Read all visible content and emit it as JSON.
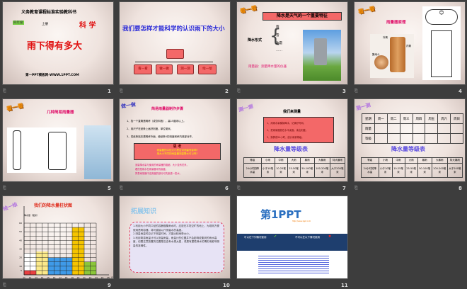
{
  "slides": [
    {
      "n": "1",
      "series": "义务教育课程标准实验教科书",
      "grade": "四年级",
      "term": "上册",
      "subject": "科 学",
      "title": "雨下得有多大",
      "footer": "第一PPT模板网-WWW.1PPT.COM"
    },
    {
      "n": "2",
      "title": "我们要怎样才能科学的认识雨下的大小",
      "root": "",
      "steps": [
        "看一看",
        "做一做",
        "测一测",
        "绘一绘"
      ]
    },
    {
      "n": "3",
      "tag": "看一看",
      "header": "降水是天气的一个重要特征",
      "label": "降水形式",
      "forms": [
        "雨",
        "雪",
        "冰雹",
        "……"
      ],
      "caption": "雨量器：测量降水量的仪器"
    },
    {
      "n": "4",
      "tag": "看一看",
      "title": "雨量器原理",
      "labels": [
        "外筒",
        "内筒",
        "集雨斗"
      ]
    },
    {
      "n": "5",
      "tag": "看一看",
      "title": "几种简易雨量器"
    },
    {
      "n": "6",
      "tag": "做一做",
      "title": "简易雨量器制作步骤",
      "steps": [
        "1、找一个直筒透明杯（或饮料瓶），高15厘米以上。",
        "2、用尺子在纸条上画好刻度，单位毫米。",
        "3、将纸条贴在透明杯外面，使纸条0的刻度和杯内底部对齐。"
      ],
      "think_title": "思 考",
      "think": [
        "雨量器的口径大小是否对测量有影响?",
        "用大小不同的雨量器测量降水可以吗?"
      ],
      "notes": [
        "测量降水量与使用的雨量器的粗细、大小没有关系，",
        "看的是雨水在雨量器中的高度。",
        "简易雨量器中没刻度的部分可先倒进一些水。"
      ]
    },
    {
      "n": "7",
      "tag": "测一测",
      "title": "我们来测量",
      "steps": [
        "1、用雨水量模拟降水，记录好时间。",
        "2、把雨量器放在水平桌面，读出刻度。",
        "3、换算成24小时，统计雨量等级。"
      ],
      "table_title": "降水量等级表",
      "header": [
        "等级",
        "小雨",
        "中雨",
        "大雨",
        "暴雨",
        "大暴雨",
        "特大暴雨"
      ],
      "row": [
        "24小时的降水量",
        "小于10毫米",
        "10-25毫米",
        "25-50毫米",
        "50-100毫米",
        "100-200毫米",
        "大于200毫米"
      ]
    },
    {
      "n": "8",
      "tag": "测一测",
      "week": [
        "星期",
        "周一",
        "周二",
        "周三",
        "周四",
        "周五",
        "周六",
        "周日"
      ],
      "rows": [
        "雨量",
        "等级"
      ],
      "table_title": "降水量等级表",
      "header": [
        "等级",
        "小雨",
        "中雨",
        "大雨",
        "暴雨",
        "大暴雨",
        "特大暴雨"
      ],
      "row": [
        "24小时的降水量",
        "小于10毫米",
        "10-25毫米",
        "25-50毫米",
        "50-100毫米",
        "100-200毫米",
        "大于200毫米"
      ]
    },
    {
      "n": "9",
      "tag": "绘一绘"
    },
    {
      "n": "10",
      "title": "拓展知识",
      "paras": [
        "1.利用大小不同口径的容器做集雨水时，应放在平坦空旷的地上，为观测方便使用透明容器，将可直接以尺测量水的高度。",
        "2.测量雨量时应记下测量时间，才能比较雨势大小。",
        "3.利用简易雨量计可以测量雨量，雨量计的位置并不会影响收集到的雨水高度，但要注意放置的位置是否会有水溅太高，或是有屋檐滴水的情形而影响测量的准确性。"
      ]
    },
    {
      "n": "11",
      "logo": "第1PPT",
      "url": "http://www.1ppt.com",
      "can": "可以在下列情况使用",
      "cannot": "不可以在以下情况使用"
    }
  ],
  "chart_data": {
    "type": "bar",
    "title": "我们的降水量柱状图",
    "ylabel": "降水量（毫米）",
    "xlabel": "日期",
    "x_ticks": [
      "11",
      "12",
      "13",
      "14",
      "15",
      "16",
      "17",
      "18",
      "19",
      "20",
      "21",
      "22",
      "23",
      "24",
      "25"
    ],
    "y_ticks": [
      5,
      10,
      20,
      30,
      40,
      50,
      60
    ],
    "ylim": [
      0,
      60
    ],
    "bars": [
      {
        "from": 11,
        "to": 13,
        "value": 5,
        "color": "#e84040"
      },
      {
        "from": 11,
        "to": 13,
        "value": 20,
        "color": "#ffffff",
        "base": 5
      },
      {
        "from": 13,
        "to": 15,
        "value": 27,
        "color": "#fbe98a"
      },
      {
        "from": 15,
        "to": 19,
        "value": 20,
        "color": "#3f9ae8"
      },
      {
        "from": 19,
        "to": 21,
        "value": 55,
        "color": "#f5c400"
      },
      {
        "from": 21,
        "to": 23,
        "value": 15,
        "color": "#8bc63a"
      }
    ]
  }
}
